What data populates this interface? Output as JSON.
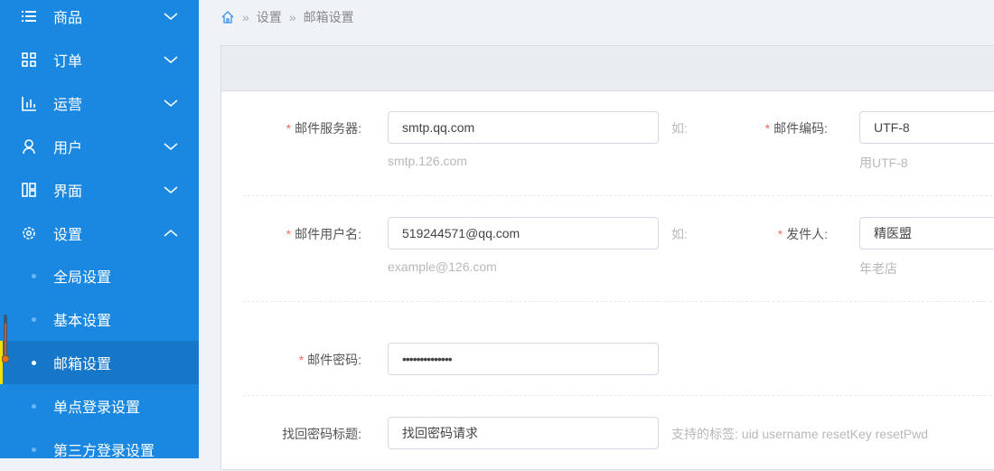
{
  "sidebar": {
    "menus": [
      {
        "label": "商品",
        "icon": "list-icon"
      },
      {
        "label": "订单",
        "icon": "grid-icon"
      },
      {
        "label": "运营",
        "icon": "bar-chart-icon"
      },
      {
        "label": "用户",
        "icon": "user-icon"
      },
      {
        "label": "界面",
        "icon": "layout-icon"
      },
      {
        "label": "设置",
        "icon": "gear-icon"
      }
    ],
    "submenu": [
      "全局设置",
      "基本设置",
      "邮箱设置",
      "单点登录设置",
      "第三方登录设置"
    ]
  },
  "breadcrumb": {
    "items": [
      "设置",
      "邮箱设置"
    ]
  },
  "form": {
    "smtp": {
      "label": "邮件服务器:",
      "value": "smtp.qq.com",
      "hint": "smtp.126.com",
      "example": "如:"
    },
    "encoding": {
      "label": "邮件编码:",
      "value": "UTF-8",
      "hint": "用UTF-8"
    },
    "username": {
      "label": "邮件用户名:",
      "value": "519244571@qq.com",
      "hint": "example@126.com",
      "example": "如:"
    },
    "sender": {
      "label": "发件人:",
      "value": "精医盟",
      "hint": "年老店"
    },
    "password": {
      "label": "邮件密码:",
      "value": "••••••••••••••"
    },
    "recover_title": {
      "label": "找回密码标题:",
      "value": "找回密码请求",
      "hint": "支持的标签: uid username resetKey resetPwd"
    },
    "required_mark": "*"
  },
  "colors": {
    "sidebar": "#1a88e0",
    "active": "#1677c8",
    "required": "#f56c6c"
  }
}
